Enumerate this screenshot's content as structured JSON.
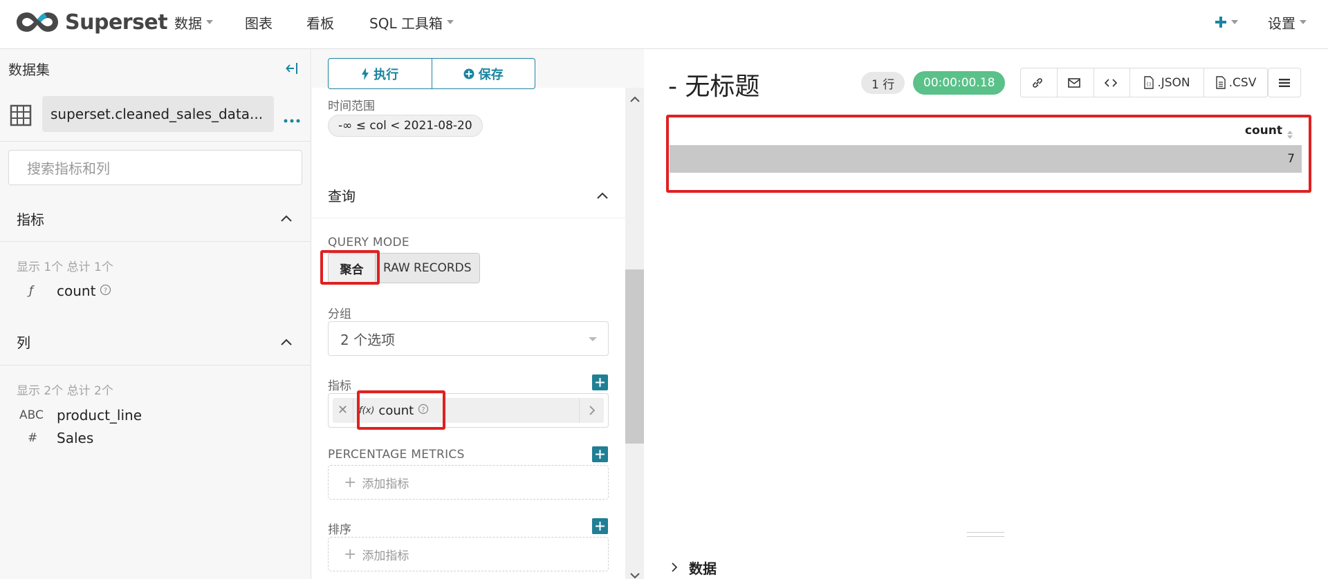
{
  "app": {
    "brand": "Superset",
    "nav": [
      {
        "label": "数据",
        "dropdown": true
      },
      {
        "label": "图表",
        "dropdown": false
      },
      {
        "label": "看板",
        "dropdown": false
      },
      {
        "label": "SQL 工具箱",
        "dropdown": true
      }
    ],
    "settings_label": "设置"
  },
  "dataset_panel": {
    "title": "数据集",
    "dataset_name": "superset.cleaned_sales_data...",
    "search_placeholder": "搜索指标和列",
    "metrics_section": {
      "title": "指标",
      "hint": "显示 1个 总计 1个",
      "items": [
        {
          "type": "ƒ",
          "name": "count"
        }
      ]
    },
    "columns_section": {
      "title": "列",
      "hint": "显示 2个 总计 2个",
      "items": [
        {
          "type": "ABC",
          "name": "product_line"
        },
        {
          "type": "#",
          "name": "Sales"
        }
      ]
    }
  },
  "control_panel": {
    "run_label": "执行",
    "save_label": "保存",
    "time_range_label": "时间范围",
    "time_range_value": "-∞ ≤ col < 2021-08-20",
    "query_section_title": "查询",
    "query_mode_label": "QUERY MODE",
    "query_mode_options": [
      "聚合",
      "RAW RECORDS"
    ],
    "query_mode_selected": "聚合",
    "groupby_label": "分组",
    "groupby_value": "2 个选项",
    "metrics_label": "指标",
    "metric_chip": {
      "fx": "f(x)",
      "label": "count"
    },
    "percentage_metrics_label": "PERCENTAGE METRICS",
    "add_metric_placeholder": "添加指标",
    "sort_label": "排序",
    "sort_placeholder": "添加指标"
  },
  "chart_area": {
    "title": "- 无标题",
    "row_count": "1 行",
    "query_time": "00:00:00.18",
    "actions": [
      {
        "icon": "link-icon",
        "label": ""
      },
      {
        "icon": "mail-icon",
        "label": ""
      },
      {
        "icon": "code-icon",
        "label": ""
      },
      {
        "icon": "json-file-icon",
        "label": ".JSON"
      },
      {
        "icon": "csv-file-icon",
        "label": ".CSV"
      }
    ],
    "table": {
      "columns": [
        "count"
      ],
      "rows": [
        [
          "7"
        ]
      ]
    },
    "data_toggle_label": "数据"
  },
  "colors": {
    "accent": "#1a85a0",
    "success": "#5ac189",
    "highlight": "#e02020"
  }
}
